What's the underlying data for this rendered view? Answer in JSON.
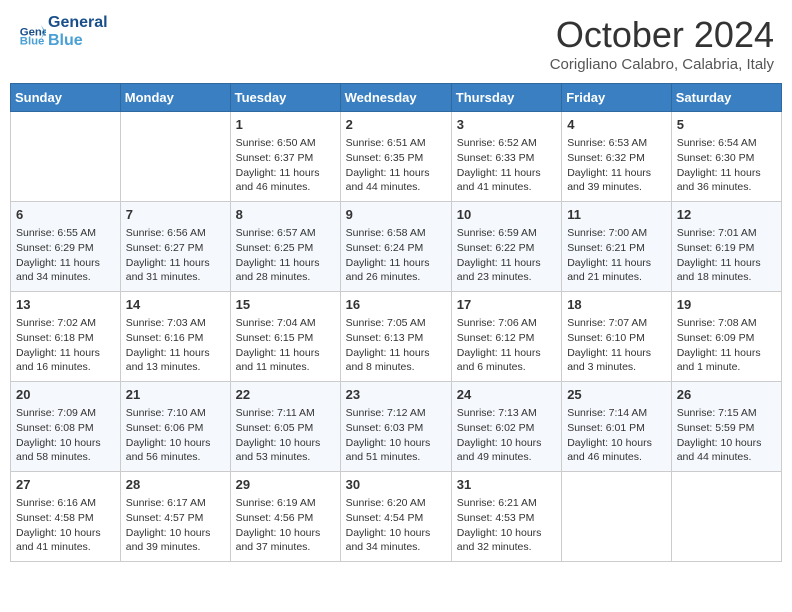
{
  "header": {
    "logo_line1": "General",
    "logo_line2": "Blue",
    "month": "October 2024",
    "location": "Corigliano Calabro, Calabria, Italy"
  },
  "days_of_week": [
    "Sunday",
    "Monday",
    "Tuesday",
    "Wednesday",
    "Thursday",
    "Friday",
    "Saturday"
  ],
  "weeks": [
    [
      {
        "day": "",
        "info": ""
      },
      {
        "day": "",
        "info": ""
      },
      {
        "day": "1",
        "info": "Sunrise: 6:50 AM\nSunset: 6:37 PM\nDaylight: 11 hours and 46 minutes."
      },
      {
        "day": "2",
        "info": "Sunrise: 6:51 AM\nSunset: 6:35 PM\nDaylight: 11 hours and 44 minutes."
      },
      {
        "day": "3",
        "info": "Sunrise: 6:52 AM\nSunset: 6:33 PM\nDaylight: 11 hours and 41 minutes."
      },
      {
        "day": "4",
        "info": "Sunrise: 6:53 AM\nSunset: 6:32 PM\nDaylight: 11 hours and 39 minutes."
      },
      {
        "day": "5",
        "info": "Sunrise: 6:54 AM\nSunset: 6:30 PM\nDaylight: 11 hours and 36 minutes."
      }
    ],
    [
      {
        "day": "6",
        "info": "Sunrise: 6:55 AM\nSunset: 6:29 PM\nDaylight: 11 hours and 34 minutes."
      },
      {
        "day": "7",
        "info": "Sunrise: 6:56 AM\nSunset: 6:27 PM\nDaylight: 11 hours and 31 minutes."
      },
      {
        "day": "8",
        "info": "Sunrise: 6:57 AM\nSunset: 6:25 PM\nDaylight: 11 hours and 28 minutes."
      },
      {
        "day": "9",
        "info": "Sunrise: 6:58 AM\nSunset: 6:24 PM\nDaylight: 11 hours and 26 minutes."
      },
      {
        "day": "10",
        "info": "Sunrise: 6:59 AM\nSunset: 6:22 PM\nDaylight: 11 hours and 23 minutes."
      },
      {
        "day": "11",
        "info": "Sunrise: 7:00 AM\nSunset: 6:21 PM\nDaylight: 11 hours and 21 minutes."
      },
      {
        "day": "12",
        "info": "Sunrise: 7:01 AM\nSunset: 6:19 PM\nDaylight: 11 hours and 18 minutes."
      }
    ],
    [
      {
        "day": "13",
        "info": "Sunrise: 7:02 AM\nSunset: 6:18 PM\nDaylight: 11 hours and 16 minutes."
      },
      {
        "day": "14",
        "info": "Sunrise: 7:03 AM\nSunset: 6:16 PM\nDaylight: 11 hours and 13 minutes."
      },
      {
        "day": "15",
        "info": "Sunrise: 7:04 AM\nSunset: 6:15 PM\nDaylight: 11 hours and 11 minutes."
      },
      {
        "day": "16",
        "info": "Sunrise: 7:05 AM\nSunset: 6:13 PM\nDaylight: 11 hours and 8 minutes."
      },
      {
        "day": "17",
        "info": "Sunrise: 7:06 AM\nSunset: 6:12 PM\nDaylight: 11 hours and 6 minutes."
      },
      {
        "day": "18",
        "info": "Sunrise: 7:07 AM\nSunset: 6:10 PM\nDaylight: 11 hours and 3 minutes."
      },
      {
        "day": "19",
        "info": "Sunrise: 7:08 AM\nSunset: 6:09 PM\nDaylight: 11 hours and 1 minute."
      }
    ],
    [
      {
        "day": "20",
        "info": "Sunrise: 7:09 AM\nSunset: 6:08 PM\nDaylight: 10 hours and 58 minutes."
      },
      {
        "day": "21",
        "info": "Sunrise: 7:10 AM\nSunset: 6:06 PM\nDaylight: 10 hours and 56 minutes."
      },
      {
        "day": "22",
        "info": "Sunrise: 7:11 AM\nSunset: 6:05 PM\nDaylight: 10 hours and 53 minutes."
      },
      {
        "day": "23",
        "info": "Sunrise: 7:12 AM\nSunset: 6:03 PM\nDaylight: 10 hours and 51 minutes."
      },
      {
        "day": "24",
        "info": "Sunrise: 7:13 AM\nSunset: 6:02 PM\nDaylight: 10 hours and 49 minutes."
      },
      {
        "day": "25",
        "info": "Sunrise: 7:14 AM\nSunset: 6:01 PM\nDaylight: 10 hours and 46 minutes."
      },
      {
        "day": "26",
        "info": "Sunrise: 7:15 AM\nSunset: 5:59 PM\nDaylight: 10 hours and 44 minutes."
      }
    ],
    [
      {
        "day": "27",
        "info": "Sunrise: 6:16 AM\nSunset: 4:58 PM\nDaylight: 10 hours and 41 minutes."
      },
      {
        "day": "28",
        "info": "Sunrise: 6:17 AM\nSunset: 4:57 PM\nDaylight: 10 hours and 39 minutes."
      },
      {
        "day": "29",
        "info": "Sunrise: 6:19 AM\nSunset: 4:56 PM\nDaylight: 10 hours and 37 minutes."
      },
      {
        "day": "30",
        "info": "Sunrise: 6:20 AM\nSunset: 4:54 PM\nDaylight: 10 hours and 34 minutes."
      },
      {
        "day": "31",
        "info": "Sunrise: 6:21 AM\nSunset: 4:53 PM\nDaylight: 10 hours and 32 minutes."
      },
      {
        "day": "",
        "info": ""
      },
      {
        "day": "",
        "info": ""
      }
    ]
  ]
}
